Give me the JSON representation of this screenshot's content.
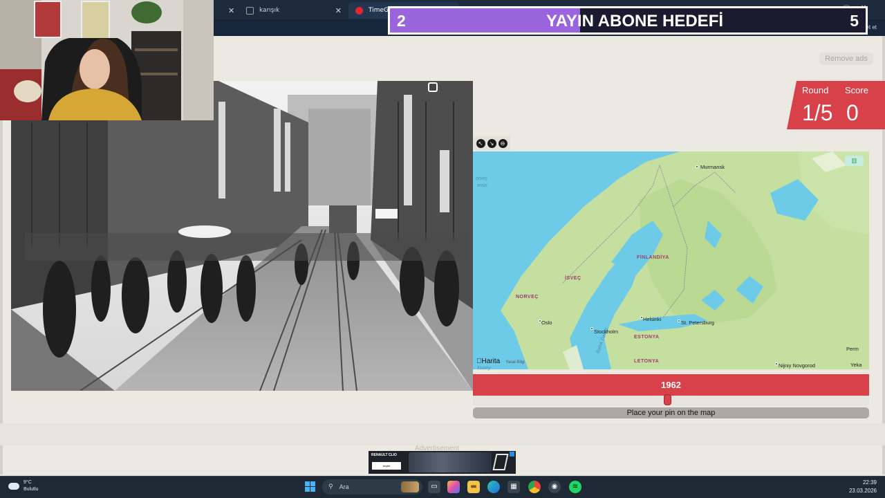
{
  "browser": {
    "tabs": [
      {
        "title": "",
        "kind": "prev"
      },
      {
        "title": "karışık",
        "kind": "generic"
      },
      {
        "title": "TimeGues",
        "kind": "active"
      }
    ],
    "chat_label": "Sohbet et",
    "colors": {
      "chrome": "#1e2b3d",
      "bar": "#17263a"
    }
  },
  "stream_overlay": {
    "goal_title": "YAYIN ABONE HEDEFİ",
    "current": "2",
    "target": "5",
    "progress_fraction": 0.4,
    "colors": {
      "fill": "#9a64dc",
      "bg": "#1b1a2e"
    }
  },
  "page": {
    "remove_ads": "Remove ads",
    "round_label": "Round",
    "score_label": "Score",
    "round_value": "1/5",
    "score_value": "0",
    "accent_color": "#d8404a"
  },
  "map": {
    "cities": [
      {
        "name": "Murmansk"
      },
      {
        "name": "Oslo"
      },
      {
        "name": "Stockholm"
      },
      {
        "name": "Helsinki"
      },
      {
        "name": "St. Petersburg"
      },
      {
        "name": "Nijniy Novgorod"
      },
      {
        "name": "Perm"
      },
      {
        "name": "Yeka"
      }
    ],
    "countries": [
      "FİNLANDİYA",
      "İSVEÇ",
      "NORVEÇ",
      "ESTONYA",
      "LETONYA"
    ],
    "seas": [
      "orveç",
      "enizi",
      "Baltık Denizi"
    ],
    "attribution": "Harita",
    "legal": "Yasal Bilgi",
    "extra": "Kuzey"
  },
  "year_slider": {
    "year": "1962",
    "position_fraction": 0.49,
    "hint": "Place your pin on the map"
  },
  "ad": {
    "label": "Advertisement",
    "brand": "RENAULT CLIO",
    "cta": "keşfet"
  },
  "taskbar": {
    "temperature": "9°C",
    "condition": "Bulutlu",
    "search_label": "Ara",
    "time": "22:39",
    "date": "23.03.2026"
  }
}
